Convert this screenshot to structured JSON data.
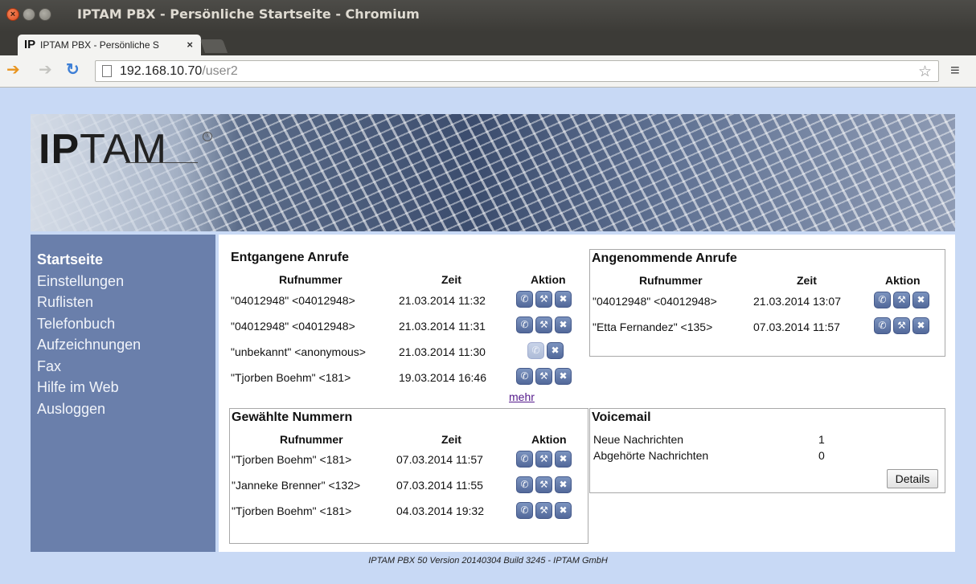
{
  "window": {
    "title": "IPTAM PBX - Persönliche Startseite - Chromium",
    "close_glyph": "×"
  },
  "tab": {
    "favicon": "IP",
    "label": "IPTAM PBX - Persönliche S",
    "close": "×"
  },
  "address_bar": {
    "host": "192.168.10.70",
    "path": "/user2"
  },
  "icons": {
    "back": "arrow-left-icon",
    "forward": "arrow-right-icon",
    "reload": "reload-icon",
    "bookmark": "star-icon",
    "menu": "menu-icon",
    "call": "phone-icon",
    "edit": "wrench-icon",
    "delete": "trash-icon"
  },
  "colors": {
    "page_bg": "#c8d9f5",
    "sidebar_bg": "#6a7fab",
    "action_button": "#5f76a6",
    "link_visited": "#551a8b"
  },
  "logo": {
    "bold": "IP",
    "rest": "TAM",
    "mark": "®"
  },
  "sidebar": {
    "items": [
      {
        "label": "Startseite",
        "active": true
      },
      {
        "label": "Einstellungen"
      },
      {
        "label": "Ruflisten"
      },
      {
        "label": "Telefonbuch"
      },
      {
        "label": "Aufzeichnungen"
      },
      {
        "label": "Fax"
      },
      {
        "label": "Hilfe im Web"
      },
      {
        "label": "Ausloggen"
      }
    ]
  },
  "columns": {
    "number": "Rufnummer",
    "time": "Zeit",
    "action": "Aktion"
  },
  "missed": {
    "title": "Entgangene Anrufe",
    "rows": [
      {
        "number": "\"04012948\" <04012948>",
        "time": "21.03.2014 11:32"
      },
      {
        "number": "\"04012948\" <04012948>",
        "time": "21.03.2014 11:31"
      },
      {
        "number": "\"unbekannt\" <anonymous>",
        "time": "21.03.2014 11:30"
      },
      {
        "number": "\"Tjorben Boehm\" <181>",
        "time": "19.03.2014 16:46"
      }
    ],
    "more": "mehr"
  },
  "answered": {
    "title": "Angenommende Anrufe",
    "rows": [
      {
        "number": "\"04012948\" <04012948>",
        "time": "21.03.2014 13:07"
      },
      {
        "number": "\"Etta Fernandez\" <135>",
        "time": "07.03.2014 11:57"
      }
    ]
  },
  "dialed": {
    "title": "Gewählte Nummern",
    "rows": [
      {
        "number": "\"Tjorben Boehm\" <181>",
        "time": "07.03.2014 11:57"
      },
      {
        "number": "\"Janneke Brenner\" <132>",
        "time": "07.03.2014 11:55"
      },
      {
        "number": "\"Tjorben Boehm\" <181>",
        "time": "04.03.2014 19:32"
      }
    ]
  },
  "voicemail": {
    "title": "Voicemail",
    "new_label": "Neue Nachrichten",
    "new_count": "1",
    "heard_label": "Abgehörte Nachrichten",
    "heard_count": "0",
    "details": "Details"
  },
  "footer": "IPTAM PBX 50 Version 20140304 Build 3245 - IPTAM GmbH"
}
